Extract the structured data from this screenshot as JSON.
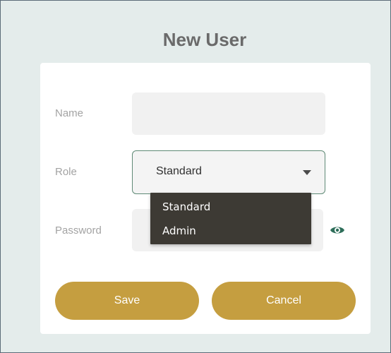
{
  "dialog": {
    "title": "New User"
  },
  "form": {
    "name_label": "Name",
    "name_value": "",
    "role_label": "Role",
    "role_value": "Standard",
    "password_label": "Password",
    "password_value": ""
  },
  "dropdown": {
    "options": [
      "Standard",
      "Admin"
    ]
  },
  "buttons": {
    "save_label": "Save",
    "cancel_label": "Cancel"
  },
  "icons": {
    "password_toggle": "eye-icon",
    "select_caret": "caret-down-icon"
  },
  "colors": {
    "accent_gold": "#c59e40",
    "select_border": "#5f8a76",
    "eye_icon": "#2e6e5a",
    "dropdown_bg": "#3d3a34",
    "page_bg": "#e4eceb"
  }
}
